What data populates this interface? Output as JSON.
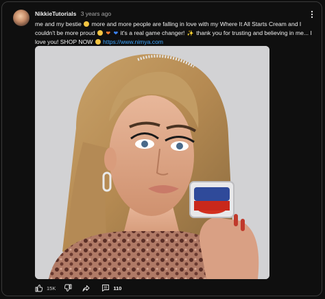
{
  "post": {
    "author": "NikkieTutorials",
    "time": "3 years ago",
    "text_line1_a": "me and my bestie",
    "text_line1_b": "more and more people are falling in love with my Where It All Starts Cream and I",
    "text_line2_a": "couldn't be more proud",
    "text_line2_b": "it's a real game changer!",
    "text_line2_c": "thank you for trusting and believing in",
    "text_line3_a": "me... I love you! SHOP NOW",
    "link": "https://www.nimya.com"
  },
  "actions": {
    "like_count": "15K",
    "comment_count": "110"
  },
  "icons": {
    "menu": "more-vert-icon",
    "like": "thumb-up-icon",
    "dislike": "thumb-down-icon",
    "share": "share-icon",
    "comment": "comment-icon"
  },
  "colors": {
    "background": "#0f0f0f",
    "text": "#f1f1f1",
    "link": "#3ea6ff",
    "muted": "#aaaaaa"
  }
}
